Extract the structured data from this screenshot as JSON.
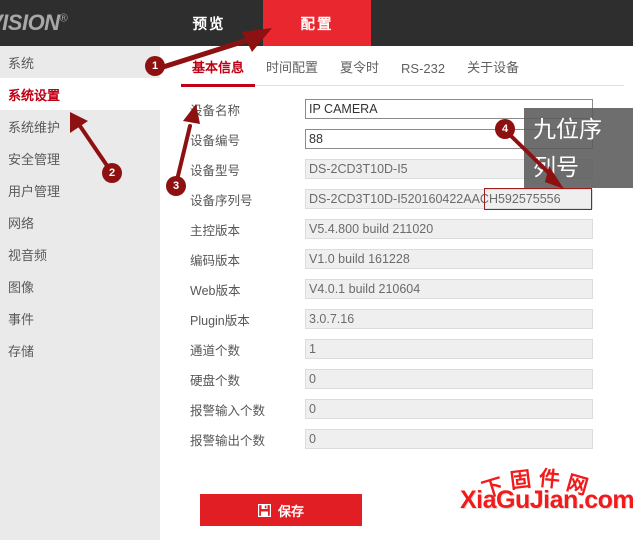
{
  "brand": {
    "logo_text": "VISION",
    "logo_reg": "®"
  },
  "topnav": {
    "items": [
      {
        "label": "预览",
        "active": false
      },
      {
        "label": "配置",
        "active": true
      }
    ]
  },
  "sidebar": {
    "items": [
      {
        "label": "系统",
        "active": false
      },
      {
        "label": "系统设置",
        "active": true
      },
      {
        "label": "系统维护",
        "active": false
      },
      {
        "label": "安全管理",
        "active": false
      },
      {
        "label": "用户管理",
        "active": false
      },
      {
        "label": "网络",
        "active": false
      },
      {
        "label": "视音频",
        "active": false
      },
      {
        "label": "图像",
        "active": false
      },
      {
        "label": "事件",
        "active": false
      },
      {
        "label": "存储",
        "active": false
      }
    ]
  },
  "tabs": [
    {
      "label": "基本信息",
      "active": true
    },
    {
      "label": "时间配置",
      "active": false
    },
    {
      "label": "夏令时",
      "active": false
    },
    {
      "label": "RS-232",
      "active": false
    },
    {
      "label": "关于设备",
      "active": false
    }
  ],
  "form": {
    "fields": [
      {
        "label": "设备名称",
        "value": "IP CAMERA",
        "readonly": false
      },
      {
        "label": "设备编号",
        "value": "88",
        "readonly": false
      },
      {
        "label": "设备型号",
        "value": "DS-2CD3T10D-I5",
        "readonly": true
      },
      {
        "label": "设备序列号",
        "value": "DS-2CD3T10D-I520160422AACH592575556",
        "readonly": true
      },
      {
        "label": "主控版本",
        "value": "V5.4.800 build 211020",
        "readonly": true
      },
      {
        "label": "编码版本",
        "value": "V1.0 build 161228",
        "readonly": true
      },
      {
        "label": "Web版本",
        "value": "V4.0.1 build 210604",
        "readonly": true
      },
      {
        "label": "Plugin版本",
        "value": "3.0.7.16",
        "readonly": true
      },
      {
        "label": "通道个数",
        "value": "1",
        "readonly": true
      },
      {
        "label": "硬盘个数",
        "value": "0",
        "readonly": true
      },
      {
        "label": "报警输入个数",
        "value": "0",
        "readonly": true
      },
      {
        "label": "报警输出个数",
        "value": "0",
        "readonly": true
      }
    ],
    "serial_highlight": "592575556"
  },
  "save": {
    "label": "保存",
    "icon": "floppy-disk-icon"
  },
  "callout": {
    "text": "九位序\n列号",
    "line1": "九位序",
    "line2": "列号"
  },
  "annotations": {
    "markers": [
      {
        "id": "1",
        "label": "1"
      },
      {
        "id": "2",
        "label": "2"
      },
      {
        "id": "3",
        "label": "3"
      },
      {
        "id": "4",
        "label": "4"
      }
    ],
    "arrow_color": "#8e1112"
  },
  "watermark": {
    "top_text": "下固件网",
    "top_chars": [
      "下",
      "固",
      "件",
      "网"
    ],
    "bottom_text": "XiaGuJian.com",
    "color": "#f21a1a"
  },
  "colors": {
    "accent_red": "#e8272e",
    "dark_red": "#c00014",
    "save_red": "#e01e23",
    "topbar": "#2e2e2e",
    "sidebar": "#eaeaea",
    "marker": "#8e1112"
  }
}
